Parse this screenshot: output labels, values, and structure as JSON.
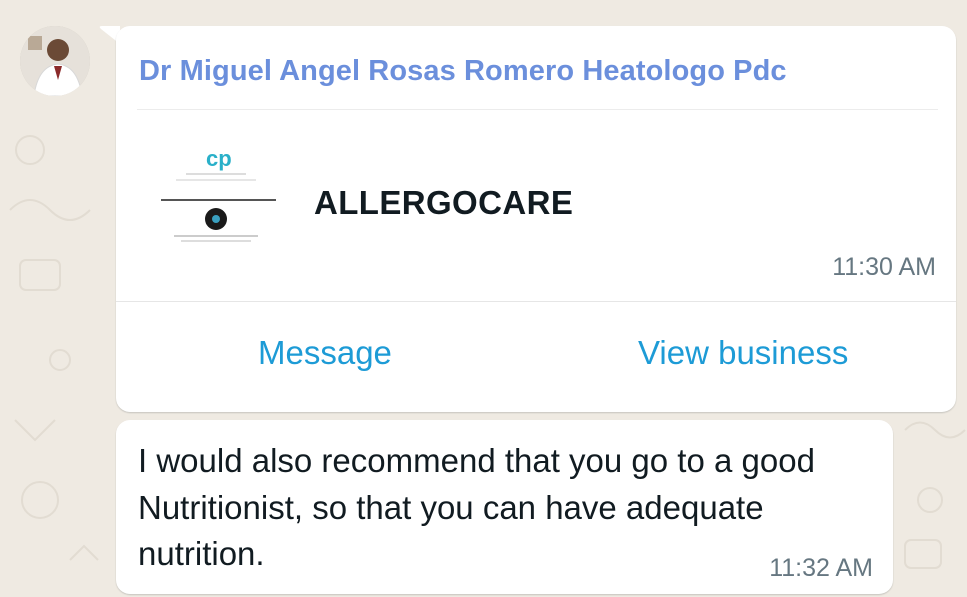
{
  "sender": {
    "name": "Dr Miguel Angel Rosas Romero Heatologo Pdc",
    "avatar_icon": "doctor-avatar",
    "name_color": "#6b8fdc"
  },
  "business_card": {
    "logo_icon": "allergocare-logo",
    "business_name": "ALLERGOCARE",
    "time": "11:30 AM",
    "actions": {
      "message_label": "Message",
      "view_business_label": "View business"
    },
    "action_color": "#1d9bd6"
  },
  "message": {
    "text": "I would also recommend that you go to a good Nutritionist, so that you can have adequate nutrition.",
    "time": "11:32 AM"
  },
  "theme": {
    "chat_background": "#efeae2",
    "bubble_background": "#ffffff"
  }
}
